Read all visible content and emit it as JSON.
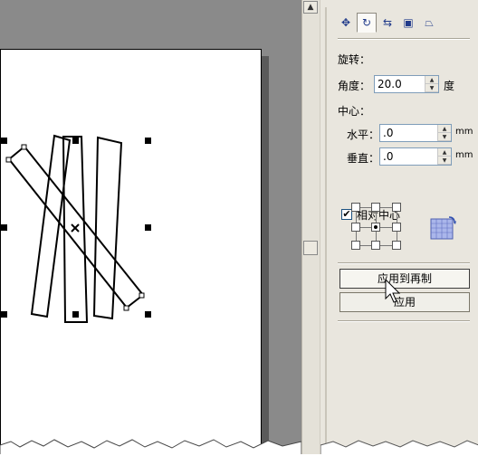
{
  "docker": {
    "tabs": [
      {
        "name": "position-tab",
        "glyph": "✥"
      },
      {
        "name": "rotate-tab",
        "glyph": "↻"
      },
      {
        "name": "scale-mirror-tab",
        "glyph": "⇆"
      },
      {
        "name": "size-tab",
        "glyph": "▣"
      },
      {
        "name": "skew-tab",
        "glyph": "⏢"
      }
    ],
    "section_rotate": "旋转：",
    "angle_label": "角度：",
    "angle_value": "20.0",
    "angle_unit": "度",
    "center_label": "中心：",
    "horizontal_label": "水平：",
    "horizontal_value": ".0",
    "horizontal_unit": "mm",
    "vertical_label": "垂直：",
    "vertical_value": ".0",
    "vertical_unit": "mm",
    "relative_center_label": "相对中心",
    "relative_center_checked": "✔",
    "apply_to_duplicate_label": "应用到再制",
    "apply_label": "应用"
  },
  "colors": {
    "canvas_bg": "#8a8a8a",
    "panel_bg": "#e9e6de",
    "accent_icon": "#203a8a"
  }
}
